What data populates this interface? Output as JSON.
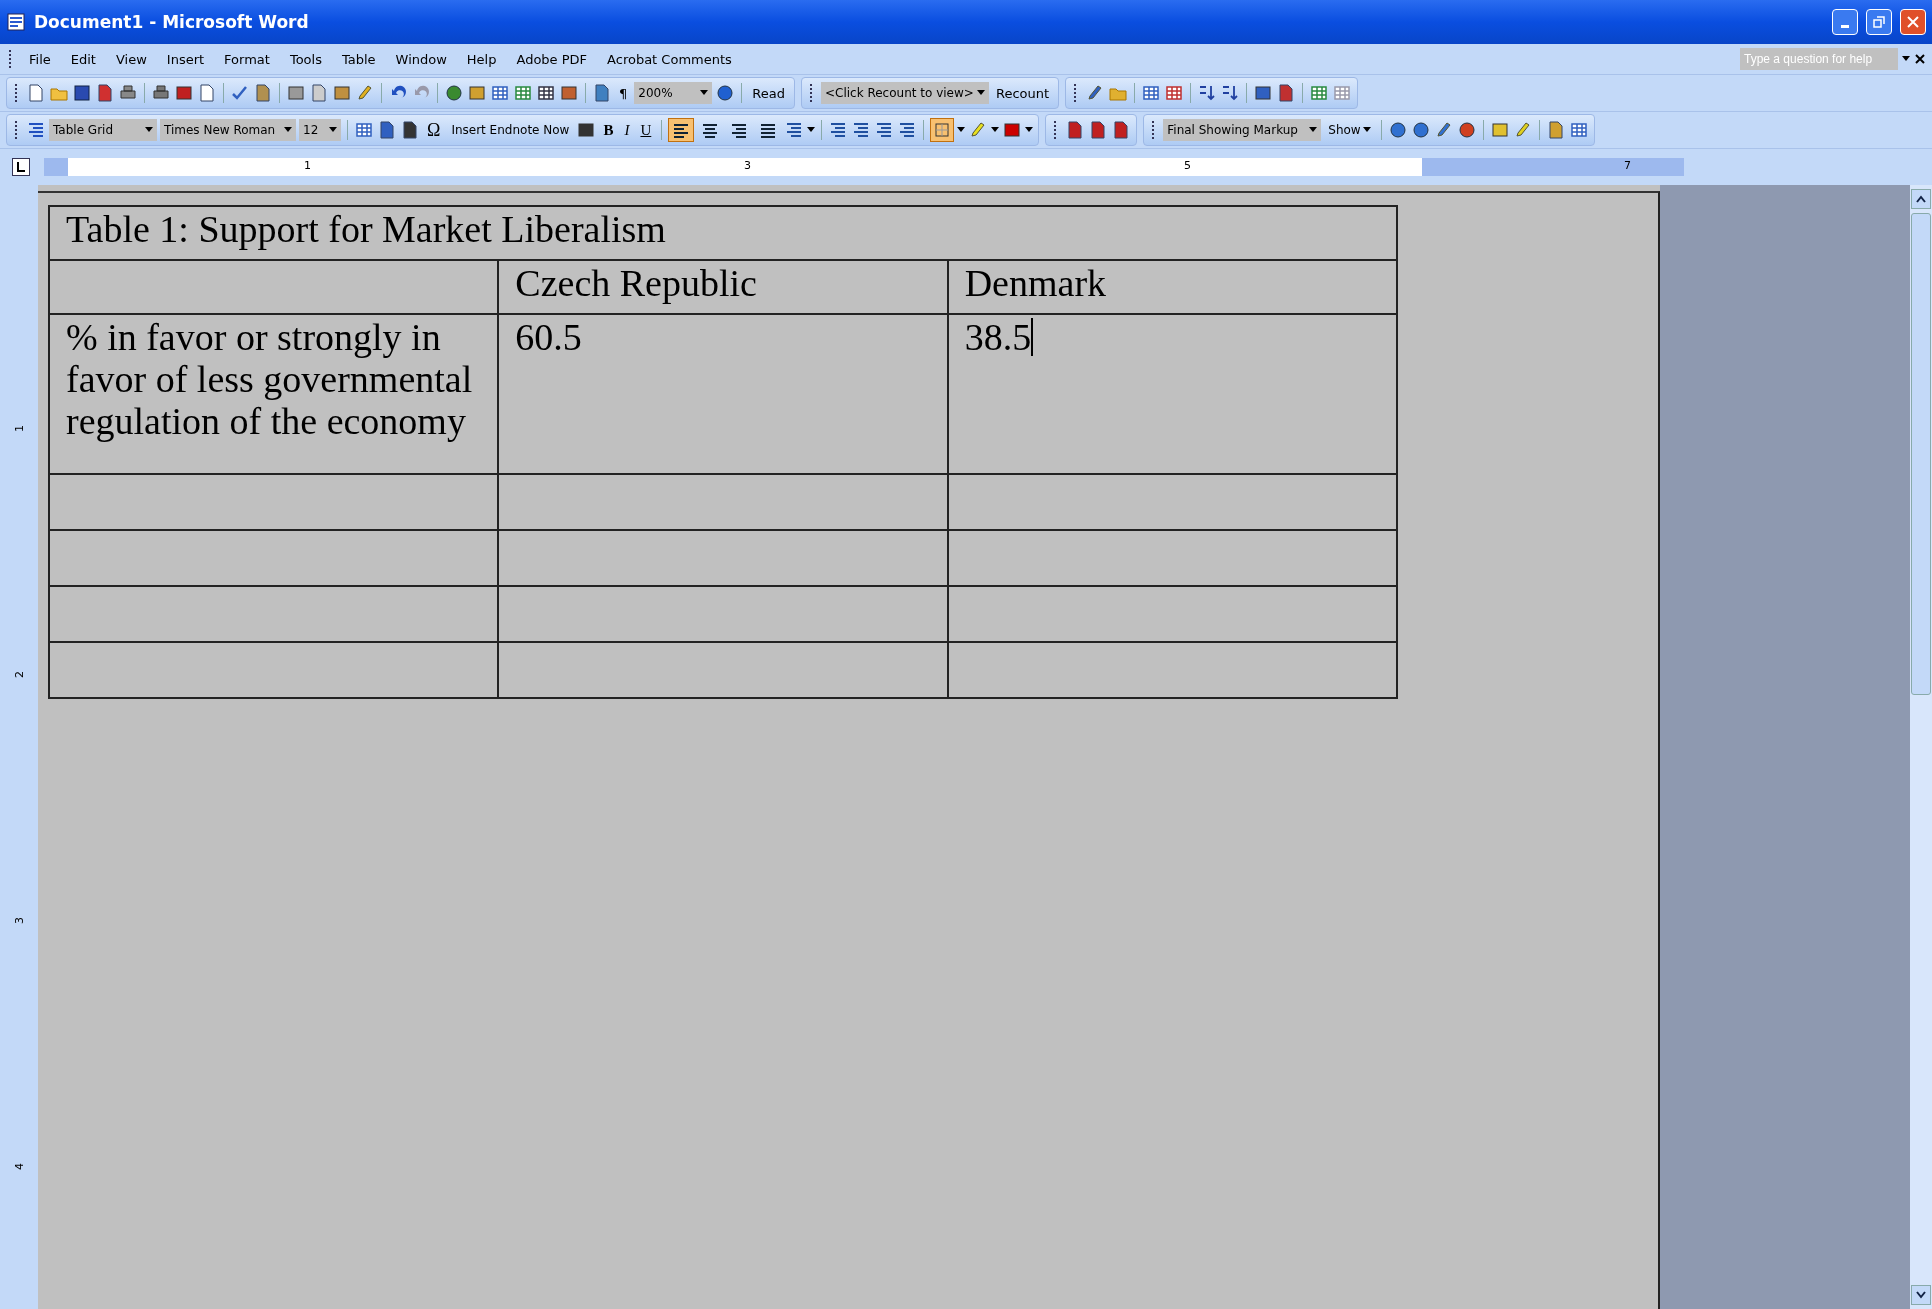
{
  "window": {
    "title": "Document1 - Microsoft Word"
  },
  "menu": [
    "File",
    "Edit",
    "View",
    "Insert",
    "Format",
    "Tools",
    "Table",
    "Window",
    "Help",
    "Adobe PDF",
    "Acrobat Comments"
  ],
  "help_box": {
    "placeholder": "Type a question for help"
  },
  "standard_toolbar": {
    "pilcrow": "¶",
    "zoom": "200%",
    "read": "Read",
    "recount_combo": "<Click Recount to view>",
    "recount": "Recount"
  },
  "formatting_toolbar": {
    "style": "Table Grid",
    "font": "Times New Roman",
    "size": "12",
    "omega": "Ω",
    "endnote": "Insert Endnote Now",
    "bold": "B",
    "italic": "I",
    "underline": "U",
    "alignment": [
      {
        "selected": true
      },
      {
        "selected": false
      },
      {
        "selected": false
      },
      {
        "selected": false
      }
    ],
    "borders_selected": true,
    "markup": "Final Showing Markup",
    "show": "Show"
  },
  "ruler": {
    "numbers": [
      "1",
      "3",
      "5",
      "7"
    ]
  },
  "vertical_ruler": {
    "numbers": [
      "1",
      "2",
      "3",
      "4"
    ]
  },
  "table": {
    "title": "Table 1: Support for Market Liberalism",
    "columns": [
      "",
      "Czech Republic",
      "Denmark"
    ],
    "rows": [
      [
        "% in favor or strongly in favor of less governmental regulation of the economy",
        "60.5",
        "38.5"
      ],
      [
        "",
        "",
        ""
      ],
      [
        "",
        "",
        ""
      ],
      [
        "",
        "",
        ""
      ],
      [
        "",
        "",
        ""
      ]
    ]
  }
}
